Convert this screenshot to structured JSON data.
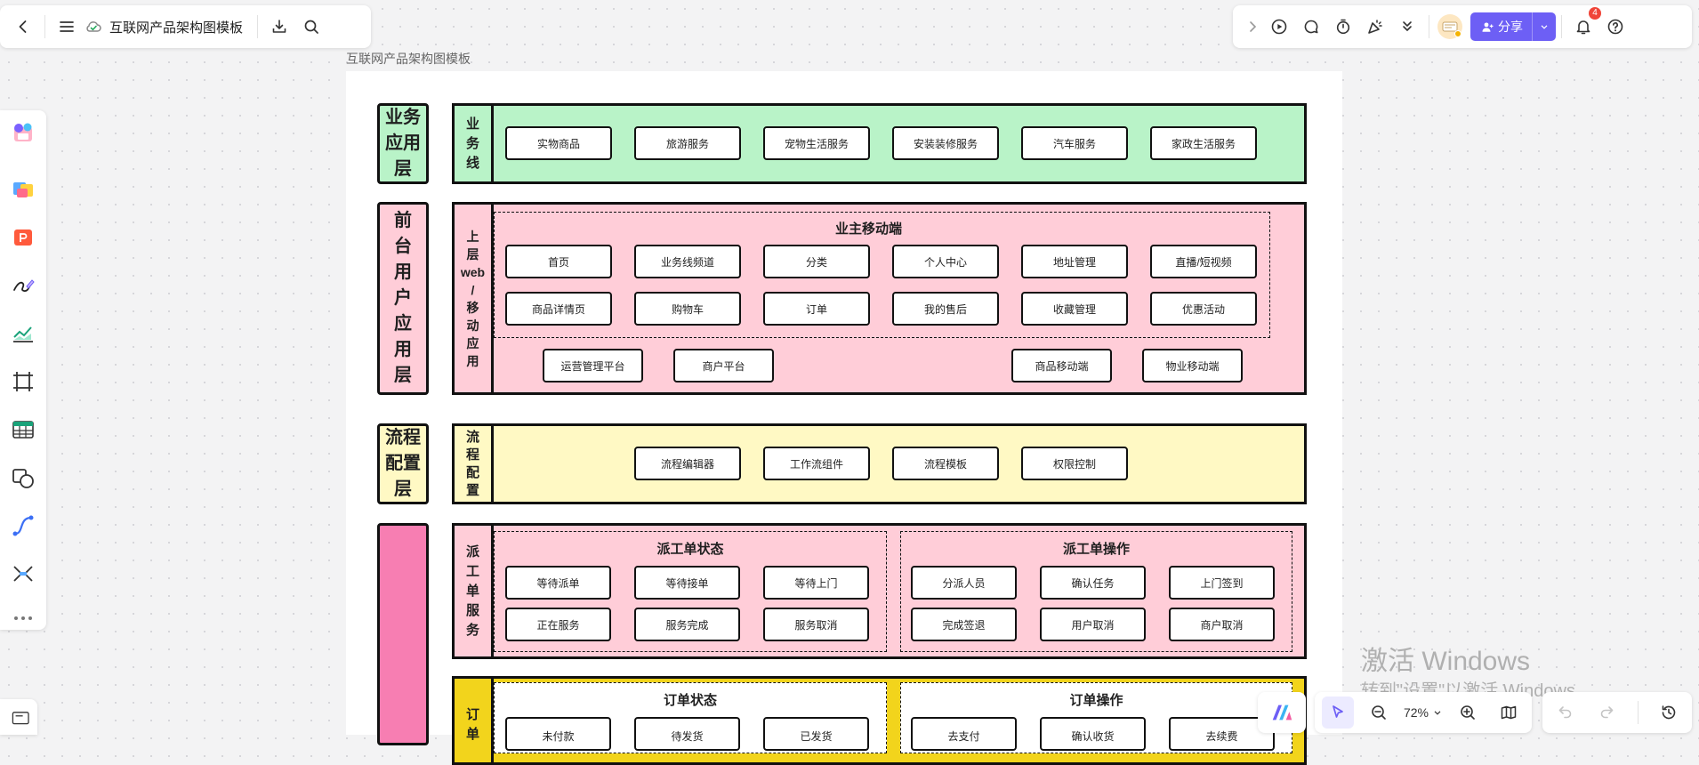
{
  "header": {
    "doc_title": "互联网产品架构图模板",
    "share_label": "分享",
    "notification_count": "4"
  },
  "canvas": {
    "frame_label": "互联网产品架构图模板"
  },
  "layers": {
    "business": {
      "label": "业务\n应用\n层",
      "strip": "业\n务\n线",
      "items": [
        "实物商品",
        "旅游服务",
        "宠物生活服务",
        "安装装修服务",
        "汽车服务",
        "家政生活服务"
      ]
    },
    "frontend": {
      "label": "前\n台\n用\n户\n应\n用\n层",
      "strip": "上\n层\nweb\n/\n移\n动\n应\n用",
      "group_title": "业主移动端",
      "row1": [
        "首页",
        "业务线频道",
        "分类",
        "个人中心",
        "地址管理",
        "直播/短视频"
      ],
      "row2": [
        "商品详情页",
        "购物车",
        "订单",
        "我的售后",
        "收藏管理",
        "优惠活动"
      ],
      "row3": [
        "运营管理平台",
        "商户平台",
        "商品移动端",
        "物业移动端"
      ]
    },
    "process": {
      "label": "流程\n配置\n层",
      "strip": "流\n程\n配\n置",
      "items": [
        "流程编辑器",
        "工作流组件",
        "流程模板",
        "权限控制"
      ]
    },
    "dispatch": {
      "strip": "派\n工\n单\n服\n务",
      "status_title": "派工单状态",
      "status_row1": [
        "等待派单",
        "等待接单",
        "等待上门"
      ],
      "status_row2": [
        "正在服务",
        "服务完成",
        "服务取消"
      ],
      "op_title": "派工单操作",
      "op_row1": [
        "分派人员",
        "确认任务",
        "上门签到"
      ],
      "op_row2": [
        "完成签退",
        "用户取消",
        "商户取消"
      ]
    },
    "order": {
      "strip": "订\n单",
      "status_title": "订单状态",
      "status_row1": [
        "未付款",
        "待发货",
        "已发货"
      ],
      "op_title": "订单操作",
      "op_row1": [
        "去支付",
        "确认收货",
        "去续费"
      ]
    }
  },
  "watermark": {
    "line1": "激活 Windows",
    "line2": "转到\"设置\"以激活 Windows。"
  },
  "bottom_bar": {
    "zoom": "72%"
  },
  "colors": {
    "business": "#b9f3c8",
    "frontend": "#ffcdd8",
    "process": "#fff9c4",
    "dispatch": "#ffcdd8",
    "dispatch_label": "#f77eb2",
    "order": "#f2d41c",
    "accent": "#6d5ff5"
  }
}
